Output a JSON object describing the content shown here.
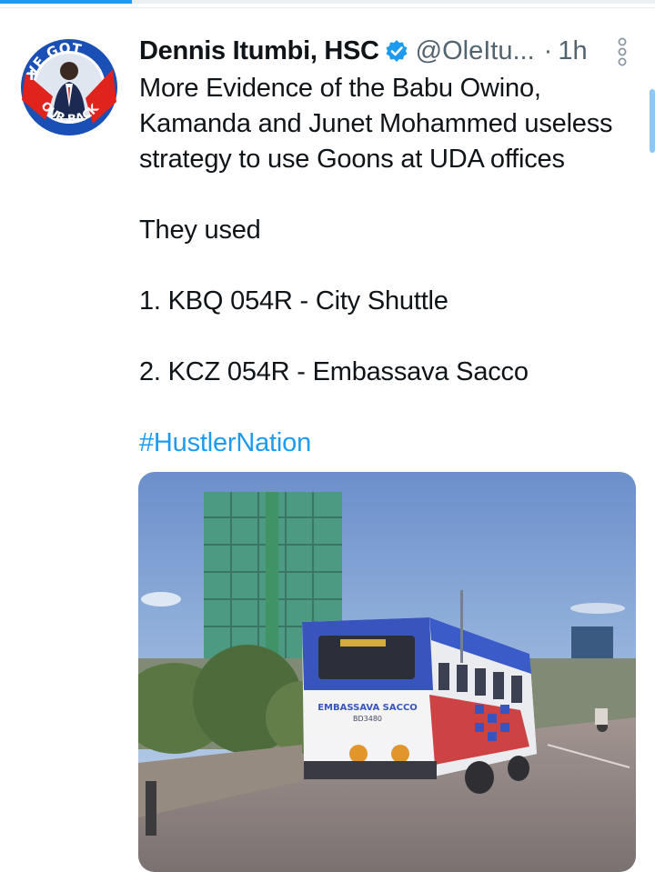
{
  "tweet": {
    "author_name": "Dennis Itumbi, HSC",
    "handle": "@OleItu...",
    "separator": "·",
    "time": "1h",
    "lines": [
      "More Evidence of the Babu Owino,",
      "Kamanda and Junet Mohammed useless",
      "strategy to use Goons at UDA offices"
    ],
    "they_used": "They used",
    "item1": "1. KBQ 054R - City Shuttle",
    "item2": "2. KCZ 054R - Embassava Sacco",
    "hashtag": "#HustlerNation"
  },
  "avatar": {
    "ring_top": "VE GOT",
    "ring_bottom": "OUR BACK",
    "ring_left": "I"
  },
  "media": {
    "bus_sign": "EMBASSAVA SACCO",
    "bus_sign_sub": "BD3480"
  },
  "colors": {
    "accent": "#1d9bf0",
    "text": "#0f1419",
    "secondary": "#536471",
    "avatar_ring": "#1a4fb5",
    "avatar_badge_red": "#e0231c"
  },
  "icons": {
    "verified": "verified-badge-icon",
    "more": "more-vertical-icon"
  }
}
